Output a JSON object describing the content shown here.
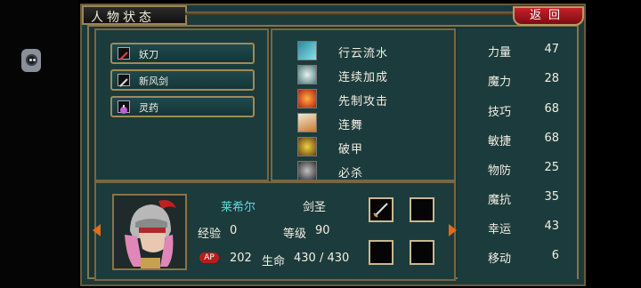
{
  "header": {
    "title": "人物状态",
    "back_label": "返回"
  },
  "items": [
    {
      "label": "妖刀",
      "icon": "blade-icon"
    },
    {
      "label": "新风剑",
      "icon": "sword-icon"
    },
    {
      "label": "灵药",
      "icon": "potion-icon"
    }
  ],
  "skills": [
    {
      "label": "行云流水",
      "icon": "wind-sword-icon"
    },
    {
      "label": "连续加成",
      "icon": "cross-blades-icon"
    },
    {
      "label": "先制攻击",
      "icon": "fire-strike-icon"
    },
    {
      "label": "连舞",
      "icon": "claw-icon"
    },
    {
      "label": "破甲",
      "icon": "gear-burst-icon"
    },
    {
      "label": "必杀",
      "icon": "skull-icon"
    }
  ],
  "stats": [
    {
      "name": "力量",
      "value": "47"
    },
    {
      "name": "魔力",
      "value": "28"
    },
    {
      "name": "技巧",
      "value": "68"
    },
    {
      "name": "敏捷",
      "value": "68"
    },
    {
      "name": "物防",
      "value": "25"
    },
    {
      "name": "魔抗",
      "value": "35"
    },
    {
      "name": "幸运",
      "value": "43"
    },
    {
      "name": "移动",
      "value": "6"
    }
  ],
  "character": {
    "name": "莱希尔",
    "class": "剑圣",
    "exp_label": "经验",
    "exp": "0",
    "level_label": "等级",
    "level": "90",
    "ap_label": "AP",
    "ap": "202",
    "hp_label": "生命",
    "hp": "430 / 430"
  },
  "colors": {
    "panel": "#1c3b3c",
    "border": "#8a7446",
    "accent_red": "#c8202a",
    "name_cyan": "#5ed8e0"
  }
}
